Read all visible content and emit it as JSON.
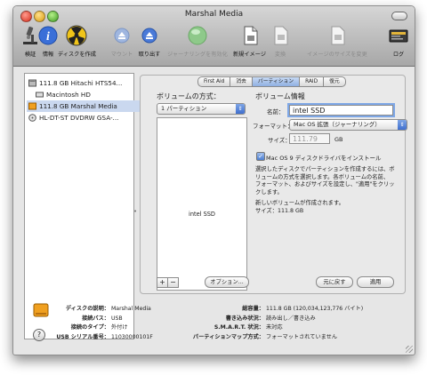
{
  "window": {
    "title": "Marshal Media"
  },
  "toolbar": [
    {
      "label": "検証",
      "icon": "verify-microscope-icon",
      "enabled": true
    },
    {
      "label": "情報",
      "icon": "info-icon",
      "enabled": true
    },
    {
      "label": "ディスクを作成",
      "icon": "burn-radiation-icon",
      "enabled": true
    },
    {
      "label": "マウント",
      "icon": "mount-icon",
      "enabled": false
    },
    {
      "label": "取り出す",
      "icon": "eject-icon",
      "enabled": true
    },
    {
      "label": "ジャーナリングを有効化",
      "icon": "journaling-icon",
      "enabled": false
    },
    {
      "label": "新規イメージ",
      "icon": "new-image-icon",
      "enabled": true
    },
    {
      "label": "変換",
      "icon": "convert-icon",
      "enabled": false
    },
    {
      "label": "イメージのサイズを変更",
      "icon": "resize-image-icon",
      "enabled": false
    },
    {
      "label": "ログ",
      "icon": "log-icon",
      "enabled": true
    }
  ],
  "sidebar": {
    "items": [
      {
        "label": "111.8 GB Hitachi HTS54...",
        "icon": "hard-disk-icon",
        "selected": false
      },
      {
        "label": "Macintosh HD",
        "icon": "volume-icon",
        "selected": false
      },
      {
        "label": "111.8 GB Marshal Media",
        "icon": "usb-disk-icon",
        "selected": true
      },
      {
        "label": "HL-DT-ST DVDRW GSA-...",
        "icon": "optical-drive-icon",
        "selected": false
      }
    ]
  },
  "tabs": [
    {
      "label": "First Aid",
      "selected": false
    },
    {
      "label": "消去",
      "selected": false
    },
    {
      "label": "パーティション",
      "selected": true
    },
    {
      "label": "RAID",
      "selected": false
    },
    {
      "label": "復元",
      "selected": false
    }
  ],
  "partition": {
    "scheme_heading": "ボリュームの方式：",
    "scheme_value": "1 パーティション",
    "volume_label": "intel SSD",
    "info_heading": "ボリューム情報",
    "name_label": "名前：",
    "name_value": "intel SSD",
    "format_label": "フォーマット：",
    "format_value": "Mac OS 拡張（ジャーナリング）",
    "size_label": "サイズ：",
    "size_value": "111.79",
    "size_unit": "GB",
    "checkbox_label": "Mac OS 9 ディスクドライバをインストール",
    "checkbox_checked": true,
    "description_lines": [
      "選択したディスクでパーティションを作成するには、ボ",
      "リュームの方式を選択します。各ボリュームの名前、",
      "フォーマット、およびサイズを設定し、\"適用\"をクリッ",
      "クします。"
    ],
    "result_lines": [
      "新しいボリュームが作成されます。",
      "サイズ：111.8 GB"
    ],
    "add_button": "+",
    "remove_button": "−",
    "options_button": "オプション...",
    "revert_button": "元に戻す",
    "apply_button": "適用"
  },
  "info_panel": {
    "left": [
      {
        "key": "ディスクの説明：",
        "value": "Marshal Media"
      },
      {
        "key": "接続バス：",
        "value": "USB"
      },
      {
        "key": "接続のタイプ：",
        "value": "外付け"
      },
      {
        "key": "USB シリアル番号：",
        "value": "11030000101F"
      }
    ],
    "right": [
      {
        "key": "総容量：",
        "value": "111.8 GB (120,034,123,776 バイト)"
      },
      {
        "key": "書き込み状況：",
        "value": "読み出し／書き込み"
      },
      {
        "key": "S.M.A.R.T. 状況：",
        "value": "未対応"
      },
      {
        "key": "パーティションマップ方式：",
        "value": "フォーマットされていません"
      }
    ]
  },
  "help": {
    "label": "?"
  },
  "colors": {
    "accent": "#3f6fce",
    "selection": "#cad8ef",
    "focus_ring": "#7ea7e6"
  }
}
